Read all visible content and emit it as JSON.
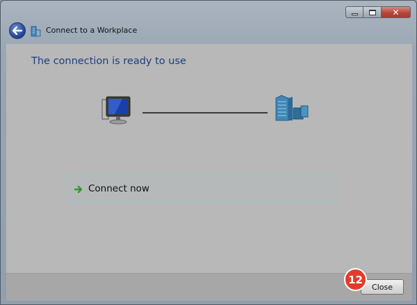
{
  "window": {
    "title": "Connect to a Workplace",
    "caption_buttons": [
      "minimize-icon",
      "maximize-icon",
      "close-icon"
    ],
    "close_glyph": "✕"
  },
  "main": {
    "heading": "The connection is ready to use",
    "icons": [
      "computer-icon",
      "workplace-network-icon"
    ],
    "option": {
      "label": "Connect now",
      "icon": "green-arrow-icon"
    }
  },
  "footer": {
    "close_label": "Close"
  },
  "annotation": {
    "step": "12",
    "color": "#e23c2a"
  },
  "colors": {
    "heading": "#1d3f7e",
    "option_border": "#97c7c7",
    "arrow": "#2c9a2c"
  }
}
